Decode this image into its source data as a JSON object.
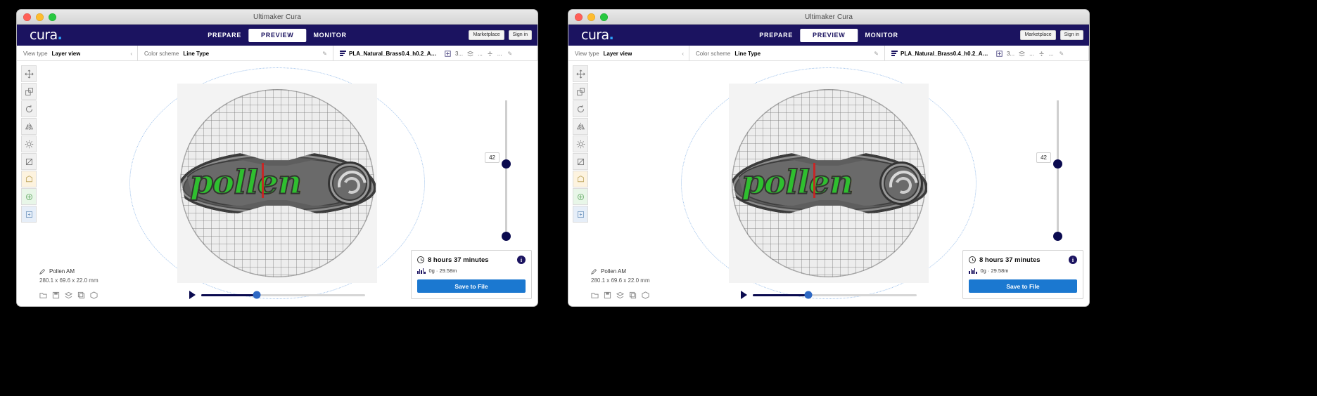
{
  "window": {
    "title": "Ultimaker Cura",
    "traffic_lights": [
      "close",
      "minimize",
      "zoom"
    ]
  },
  "navbar": {
    "logo": "cura",
    "logo_accent": ".",
    "tabs": [
      {
        "label": "PREPARE",
        "active": false
      },
      {
        "label": "PREVIEW",
        "active": true
      },
      {
        "label": "MONITOR",
        "active": false
      }
    ],
    "marketplace_label": "Marketplace",
    "signin_label": "Sign in"
  },
  "settings": {
    "view_type_label": "View type",
    "view_type_value": "Layer view",
    "collapse_icon": "‹",
    "color_scheme_label": "Color scheme",
    "color_scheme_value": "Line Type",
    "edit_icon": "✎",
    "material_value": "PLA_Natural_Brass0.4_h0.2_AC 0...",
    "extruder_value": "3...",
    "extra_1": "...",
    "extra_2": "...",
    "extra_3": "..."
  },
  "viewport": {
    "model_word": "pollen",
    "layer_slider_value": "42",
    "object_name": "Pollen AM",
    "object_dimensions": "280.1 x 69.6 x 22.0 mm"
  },
  "job": {
    "time_label": "8 hours 37 minutes",
    "material_label": "0g · 29.58m",
    "save_label": "Save to File",
    "info_glyph": "i"
  },
  "colors": {
    "navbar": "#1b1360",
    "accent_blue": "#2da4ff",
    "save_button": "#1b78d0",
    "slider_handle": "#0a0a4f",
    "model_green": "#3cc43c",
    "model_yellow": "#e8e800"
  },
  "tools": [
    "move-tool",
    "scale-tool",
    "rotate-tool",
    "mirror-tool",
    "per-model-settings-tool",
    "support-blocker-tool",
    "extension-a-tool",
    "extension-b-tool",
    "extension-c-tool"
  ],
  "bottom_icons": [
    "open-file-icon",
    "save-icon",
    "layers-icon",
    "copy-icon",
    "box-icon"
  ]
}
